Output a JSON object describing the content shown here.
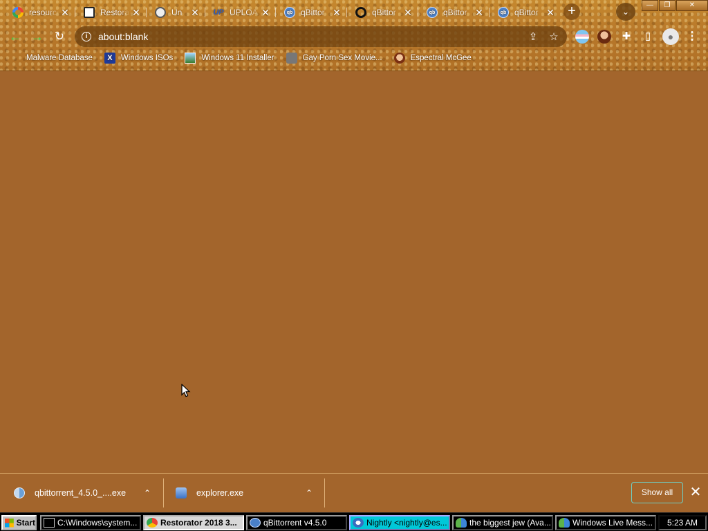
{
  "browser": {
    "tabs": [
      {
        "title": "resource",
        "icon": "google-icon"
      },
      {
        "title": "Restorator",
        "icon": "monitor-icon"
      },
      {
        "title": "Un",
        "icon": "globe-icon"
      },
      {
        "title": "UPLOA",
        "icon": "upload-logo-icon"
      },
      {
        "title": "qBittor",
        "icon": "qbittorrent-icon"
      },
      {
        "title": "qBittor",
        "icon": "ring-icon"
      },
      {
        "title": "qBittor",
        "icon": "qbittorrent-icon"
      },
      {
        "title": "qBittor",
        "icon": "qbittorrent-icon"
      }
    ],
    "tab_close_glyph": "✕",
    "new_tab_glyph": "+",
    "tab_search_glyph": "⌄",
    "window_controls": {
      "minimize": "—",
      "restore": "❐",
      "close": "✕"
    },
    "toolbar": {
      "back_glyph": "←",
      "forward_glyph": "→",
      "reload_glyph": "↻",
      "url": "about:blank",
      "info_glyph": "i",
      "share_glyph": "⇪",
      "bookmark_glyph": "☆",
      "puzzle_glyph": "✚",
      "sidepanel_glyph": "▯",
      "profile_glyph": "●",
      "menu_glyph": "⋮"
    },
    "bookmarks": [
      {
        "label": "Malware Database",
        "icon": "blank"
      },
      {
        "label": "Windows ISOs",
        "icon": "x-icon",
        "glyph": "X"
      },
      {
        "label": "Windows 11 Installer",
        "icon": "image-icon"
      },
      {
        "label": "Gay Porn Sex Movie...",
        "icon": "disk-icon"
      },
      {
        "label": "Espectral McGee",
        "icon": "face-icon"
      }
    ]
  },
  "downloads": {
    "items": [
      {
        "name": "qbittorrent_4.5.0_....exe",
        "chevron": "⌃"
      },
      {
        "name": "explorer.exe",
        "chevron": "⌃"
      }
    ],
    "show_all_label": "Show all",
    "close_glyph": "✕"
  },
  "taskbar": {
    "start_label": "Start",
    "tasks": [
      {
        "label": "C:\\Windows\\system...",
        "state": "normal"
      },
      {
        "label": "Restorator 2018 3...",
        "state": "active"
      },
      {
        "label": "qBittorrent v4.5.0",
        "state": "normal"
      },
      {
        "label": "Nightly <nightly@es...",
        "state": "highlight"
      },
      {
        "label": "the biggest jew (Ava...",
        "state": "normal"
      },
      {
        "label": "Windows Live Mess...",
        "state": "normal"
      }
    ],
    "clock": "5:23 AM"
  },
  "colors": {
    "page_background": "#a3652c",
    "taskbar": "#000000",
    "accent_green": "#3fd24a",
    "show_all_border": "#6fd0c5"
  }
}
